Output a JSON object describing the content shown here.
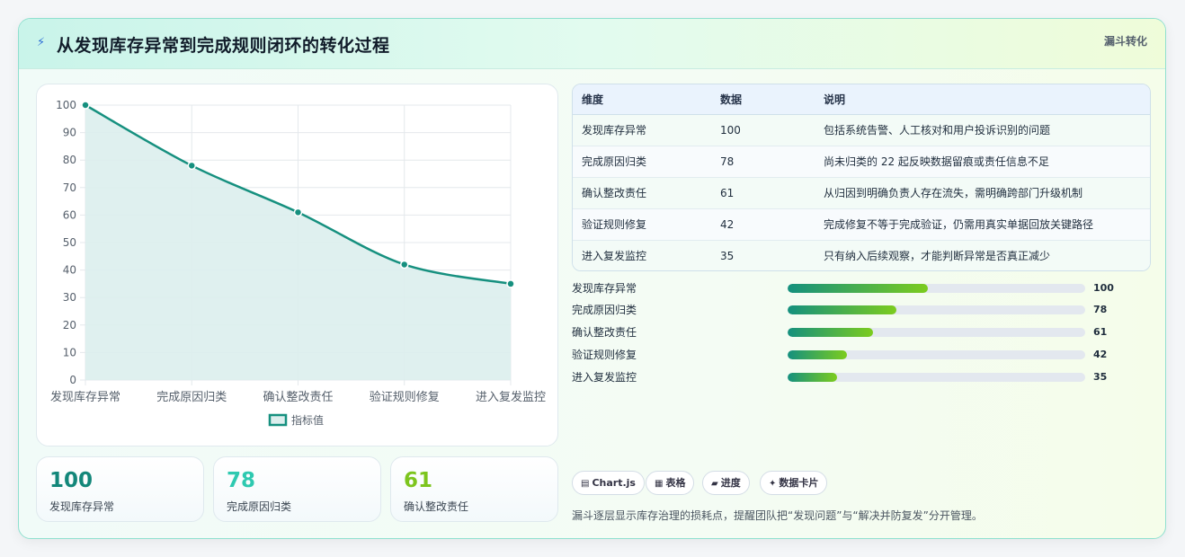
{
  "header": {
    "icon": "lightning-icon",
    "title": "从发现库存异常到完成规则闭环的转化过程",
    "badge": "漏斗转化"
  },
  "chart_data": {
    "type": "area",
    "categories": [
      "发现库存异常",
      "完成原因归类",
      "确认整改责任",
      "验证规则修复",
      "进入复发监控"
    ],
    "series": [
      {
        "name": "指标值",
        "values": [
          100,
          78,
          61,
          42,
          35
        ]
      }
    ],
    "ylim": [
      0,
      100
    ],
    "yticks": [
      0,
      10,
      20,
      30,
      40,
      50,
      60,
      70,
      80,
      90,
      100
    ],
    "grid": true,
    "legend": "bottom",
    "colors": {
      "line": "#16907f",
      "fill": "#dceeed"
    }
  },
  "stats": [
    {
      "value": "100",
      "label": "发现库存异常",
      "color": "#13877a"
    },
    {
      "value": "78",
      "label": "完成原因归类",
      "color": "#2ec9b0"
    },
    {
      "value": "61",
      "label": "确认整改责任",
      "color": "#7dc51e"
    }
  ],
  "table": {
    "headers": [
      "维度",
      "数据",
      "说明"
    ],
    "rows": [
      [
        "发现库存异常",
        "100",
        "包括系统告警、人工核对和用户投诉识别的问题"
      ],
      [
        "完成原因归类",
        "78",
        "尚未归类的 22 起反映数据留痕或责任信息不足"
      ],
      [
        "确认整改责任",
        "61",
        "从归因到明确负责人存在流失，需明确跨部门升级机制"
      ],
      [
        "验证规则修复",
        "42",
        "完成修复不等于完成验证，仍需用真实单据回放关键路径"
      ],
      [
        "进入复发监控",
        "35",
        "只有纳入后续观察，才能判断异常是否真正减少"
      ]
    ]
  },
  "progress": [
    {
      "label": "发现库存异常",
      "value": 100,
      "fraction": 0.47
    },
    {
      "label": "完成原因归类",
      "value": 78,
      "fraction": 0.367
    },
    {
      "label": "确认整改责任",
      "value": 61,
      "fraction": 0.287
    },
    {
      "label": "验证规则修复",
      "value": 42,
      "fraction": 0.198
    },
    {
      "label": "进入复发监控",
      "value": 35,
      "fraction": 0.165
    }
  ],
  "tags": [
    {
      "icon": "▤",
      "label": "Chart.js"
    },
    {
      "icon": "▦",
      "label": "表格"
    },
    {
      "icon": "▰",
      "label": "进度"
    },
    {
      "icon": "✦",
      "label": "数据卡片"
    }
  ],
  "note": "漏斗逐层显示库存治理的损耗点，提醒团队把“发现问题”与“解决并防复发”分开管理。"
}
